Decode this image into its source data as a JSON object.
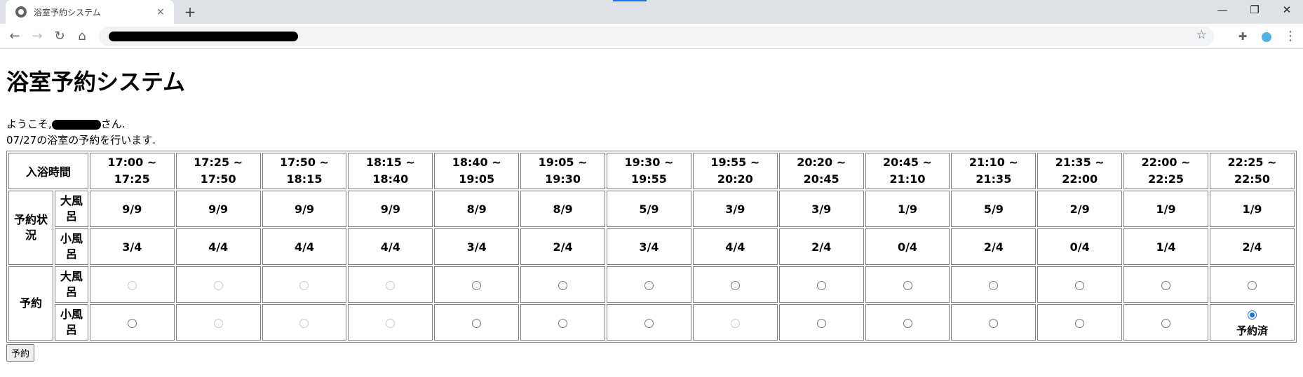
{
  "browser": {
    "tab_title": "浴室予約システム",
    "tab_close": "×",
    "new_tab": "+",
    "win_min": "—",
    "win_max": "❐",
    "win_close": "✕",
    "back": "←",
    "forward": "→",
    "reload": "↻",
    "home": "⌂",
    "star": "☆",
    "puzzle": "✚",
    "menu": "⋮"
  },
  "page": {
    "title": "浴室予約システム",
    "welcome_prefix": "ようこそ,",
    "welcome_suffix": "さん.",
    "intro": "07/27の浴室の予約を行います.",
    "submit_label": "予約"
  },
  "table": {
    "time_header": "入浴時間",
    "status_header": "予約状況",
    "reserve_header": "予約",
    "big_bath": "大風呂",
    "small_bath": "小風呂",
    "reserved_label": "予約済",
    "slots": [
      {
        "start": "17:00 ~",
        "end": "17:25",
        "big": "9/9",
        "small": "3/4",
        "big_radio": "disabled",
        "small_radio": "enabled"
      },
      {
        "start": "17:25 ~",
        "end": "17:50",
        "big": "9/9",
        "small": "4/4",
        "big_radio": "disabled",
        "small_radio": "disabled"
      },
      {
        "start": "17:50 ~",
        "end": "18:15",
        "big": "9/9",
        "small": "4/4",
        "big_radio": "disabled",
        "small_radio": "disabled"
      },
      {
        "start": "18:15 ~",
        "end": "18:40",
        "big": "9/9",
        "small": "4/4",
        "big_radio": "disabled",
        "small_radio": "disabled"
      },
      {
        "start": "18:40 ~",
        "end": "19:05",
        "big": "8/9",
        "small": "3/4",
        "big_radio": "enabled",
        "small_radio": "enabled"
      },
      {
        "start": "19:05 ~",
        "end": "19:30",
        "big": "8/9",
        "small": "2/4",
        "big_radio": "enabled",
        "small_radio": "enabled"
      },
      {
        "start": "19:30 ~",
        "end": "19:55",
        "big": "5/9",
        "small": "3/4",
        "big_radio": "enabled",
        "small_radio": "enabled"
      },
      {
        "start": "19:55 ~",
        "end": "20:20",
        "big": "3/9",
        "small": "4/4",
        "big_radio": "enabled",
        "small_radio": "disabled"
      },
      {
        "start": "20:20 ~",
        "end": "20:45",
        "big": "3/9",
        "small": "2/4",
        "big_radio": "enabled",
        "small_radio": "enabled"
      },
      {
        "start": "20:45 ~",
        "end": "21:10",
        "big": "1/9",
        "small": "0/4",
        "big_radio": "enabled",
        "small_radio": "enabled"
      },
      {
        "start": "21:10 ~",
        "end": "21:35",
        "big": "5/9",
        "small": "2/4",
        "big_radio": "enabled",
        "small_radio": "enabled"
      },
      {
        "start": "21:35 ~",
        "end": "22:00",
        "big": "2/9",
        "small": "0/4",
        "big_radio": "enabled",
        "small_radio": "enabled"
      },
      {
        "start": "22:00 ~",
        "end": "22:25",
        "big": "1/9",
        "small": "1/4",
        "big_radio": "enabled",
        "small_radio": "enabled"
      },
      {
        "start": "22:25 ~",
        "end": "22:50",
        "big": "1/9",
        "small": "2/4",
        "big_radio": "enabled",
        "small_radio": "checked"
      }
    ]
  }
}
